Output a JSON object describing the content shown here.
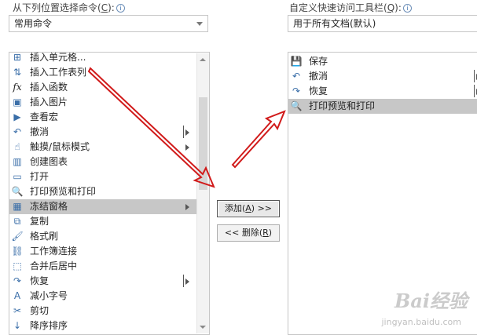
{
  "left": {
    "label": "从下列位置选择命令(",
    "label_key": "C",
    "label_tail": "):",
    "dropdown_value": "常用命令",
    "items": [
      {
        "label": "插入单元格...",
        "icon": "insert-cell-icon",
        "glyph": "⊞"
      },
      {
        "label": "插入工作表列",
        "icon": "insert-column-icon",
        "glyph": "⇅"
      },
      {
        "label": "插入函数",
        "icon": "function-icon",
        "glyph": "fx"
      },
      {
        "label": "插入图片",
        "icon": "picture-icon",
        "glyph": "▣"
      },
      {
        "label": "查看宏",
        "icon": "macro-icon",
        "glyph": "▶"
      },
      {
        "label": "撤消",
        "icon": "undo-icon",
        "glyph": "↶"
      },
      {
        "label": "触摸/鼠标模式",
        "icon": "touch-mode-icon",
        "glyph": "☝"
      },
      {
        "label": "创建图表",
        "icon": "chart-icon",
        "glyph": "▥"
      },
      {
        "label": "打开",
        "icon": "open-folder-icon",
        "glyph": "▭"
      },
      {
        "label": "打印预览和打印",
        "icon": "print-preview-icon",
        "glyph": "🔍"
      },
      {
        "label": "冻结窗格",
        "icon": "freeze-panes-icon",
        "glyph": "▦"
      },
      {
        "label": "复制",
        "icon": "copy-icon",
        "glyph": "⧉"
      },
      {
        "label": "格式刷",
        "icon": "format-painter-icon",
        "glyph": "🖌"
      },
      {
        "label": "工作簿连接",
        "icon": "workbook-connections-icon",
        "glyph": "⛓"
      },
      {
        "label": "合并后居中",
        "icon": "merge-center-icon",
        "glyph": "⬚"
      },
      {
        "label": "恢复",
        "icon": "redo-icon",
        "glyph": "↷"
      },
      {
        "label": "减小字号",
        "icon": "decrease-font-icon",
        "glyph": "A"
      },
      {
        "label": "剪切",
        "icon": "cut-icon",
        "glyph": "✂"
      },
      {
        "label": "降序排序",
        "icon": "sort-desc-icon",
        "glyph": "↓"
      }
    ]
  },
  "right": {
    "label": "自定义快速访问工具栏(",
    "label_key": "Q",
    "label_tail": "):",
    "dropdown_value": "用于所有文档(默认)",
    "items": [
      {
        "label": "保存",
        "icon": "save-icon",
        "glyph": "💾"
      },
      {
        "label": "撤消",
        "icon": "undo-icon",
        "glyph": "↶"
      },
      {
        "label": "恢复",
        "icon": "redo-icon",
        "glyph": "↷"
      },
      {
        "label": "打印预览和打印",
        "icon": "print-preview-icon",
        "glyph": "🔍"
      }
    ]
  },
  "buttons": {
    "add_pre": "添加(",
    "add_key": "A",
    "add_post": ") >>",
    "remove_pre": "<< 删除(",
    "remove_key": "R",
    "remove_post": ")"
  },
  "watermark": {
    "brand": "Bai经验",
    "url": "jingyan.baidu.com"
  },
  "colors": {
    "selection": "#c7c7c7",
    "annotation_arrow": "#d11a1a",
    "border": "#c6c6c6"
  }
}
